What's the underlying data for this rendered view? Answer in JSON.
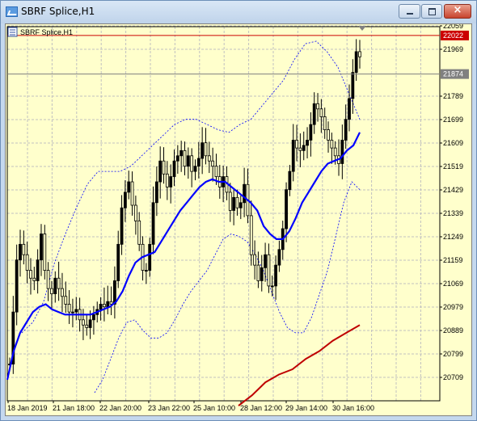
{
  "window": {
    "title": "SBRF Splice,H1",
    "close_glyph": "×"
  },
  "chart": {
    "symbol_label": "SBRF Splice,H1",
    "price_ticks": [
      "22059",
      "21969",
      "21789",
      "21699",
      "21609",
      "21519",
      "21429",
      "21339",
      "21249",
      "21159",
      "21069",
      "20979",
      "20889",
      "20799",
      "20709"
    ],
    "price_tick_values": [
      22059,
      21969,
      21789,
      21699,
      21609,
      21519,
      21429,
      21339,
      21249,
      21159,
      21069,
      20979,
      20889,
      20799,
      20709
    ],
    "current_price_label": "22022",
    "current_price": 22022,
    "hline_price_label": "21874",
    "hline_price": 21874,
    "time_labels": [
      "18 Jan 2019",
      "21 Jan 18:00",
      "22 Jan 20:00",
      "23 Jan 22:00",
      "25 Jan 10:00",
      "28 Jan 12:00",
      "29 Jan 14:00",
      "30 Jan 16:00"
    ],
    "colors": {
      "background": "#ffffcc",
      "grid": "#c0c0c0",
      "candles": "#000000",
      "ma": "#0000ff",
      "bands": "#0000ff",
      "red_line": "#bf0000",
      "price_box": "#cc0000",
      "hline_box": "#808080"
    }
  },
  "chart_data": {
    "type": "line",
    "title": "SBRF Splice,H1",
    "xlabel": "",
    "ylabel": "",
    "ylim": [
      20650,
      22080
    ],
    "x_ticks": [
      "18 Jan 2019",
      "21 Jan 18:00",
      "22 Jan 20:00",
      "23 Jan 22:00",
      "25 Jan 10:00",
      "28 Jan 12:00",
      "29 Jan 14:00",
      "30 Jan 16:00"
    ],
    "close_prices": [
      20760,
      20960,
      21160,
      21220,
      21180,
      21120,
      21090,
      21080,
      21160,
      21260,
      21120,
      21050,
      21030,
      21090,
      21050,
      21020,
      20990,
      20960,
      20960,
      20970,
      20930,
      20910,
      20900,
      20930,
      20950,
      20970,
      20990,
      20980,
      21000,
      20990,
      21080,
      21220,
      21360,
      21420,
      21460,
      21370,
      21310,
      21220,
      21120,
      21120,
      21220,
      21380,
      21460,
      21540,
      21490,
      21440,
      21480,
      21540,
      21560,
      21580,
      21520,
      21560,
      21500,
      21520,
      21550,
      21610,
      21560,
      21540,
      21520,
      21480,
      21440,
      21480,
      21420,
      21350,
      21400,
      21360,
      21380,
      21450,
      21330,
      21180,
      21140,
      21080,
      21130,
      21180,
      21060,
      21060,
      21140,
      21200,
      21280,
      21430,
      21500,
      21620,
      21590,
      21580,
      21600,
      21620,
      21680,
      21760,
      21740,
      21710,
      21660,
      21620,
      21590,
      21560,
      21530,
      21620,
      21700,
      21780,
      21880,
      21960,
      21940
    ],
    "series": [
      {
        "values": [
          20700,
          20810,
          20880,
          20920,
          20960,
          20980,
          20990,
          20970,
          20960,
          20950,
          20950,
          20950,
          20950,
          20950,
          20960,
          20970,
          20980,
          21000,
          21040,
          21100,
          21150,
          21170,
          21180,
          21190,
          21230,
          21270,
          21310,
          21350,
          21380,
          21410,
          21440,
          21460,
          21470,
          21460,
          21460,
          21440,
          21420,
          21400,
          21380,
          21350,
          21290,
          21260,
          21240,
          21240,
          21270,
          21320,
          21380,
          21420,
          21460,
          21500,
          21530,
          21540,
          21550,
          21580,
          21600,
          21650
        ]
      },
      {
        "values": [
          20880,
          20920,
          21000,
          21150,
          21260,
          21360,
          21450,
          21500,
          21500,
          21500,
          21520,
          21560,
          21600,
          21640,
          21680,
          21700,
          21700,
          21680,
          21660,
          21650,
          21680,
          21700,
          21750,
          21800,
          21850,
          21930,
          21990,
          22000,
          21960,
          21900,
          21800,
          21700
        ]
      },
      {
        "values": [
          20650,
          20700,
          20780,
          20860,
          20920,
          20930,
          20890,
          20860,
          20860,
          20880,
          20930,
          20990,
          21040,
          21080,
          21120,
          21180,
          21240,
          21260,
          21250,
          21230,
          21180,
          21120,
          21040,
          20960,
          20900,
          20880,
          20880,
          20940,
          21030,
          21120,
          21250,
          21380,
          21460,
          21430
        ]
      },
      {
        "values": [
          20600,
          20640,
          20690,
          20720,
          20740,
          20780,
          20810,
          20850,
          20880,
          20910
        ]
      }
    ]
  }
}
